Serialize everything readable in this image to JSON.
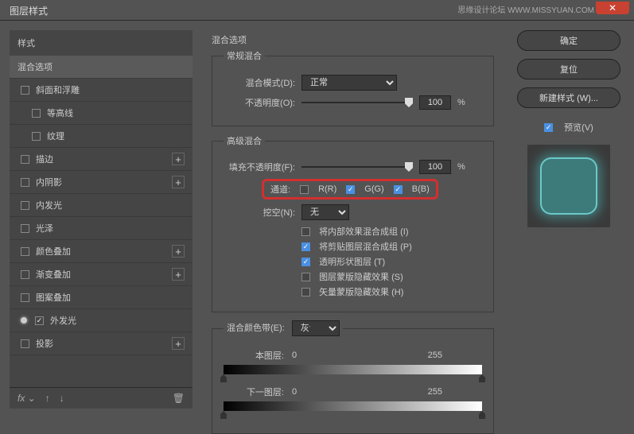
{
  "window": {
    "title": "图层样式",
    "watermark": "思缘设计论坛 WWW.MISSYUAN.COM"
  },
  "sidebar": {
    "header": "样式",
    "blending_options": "混合选项",
    "items": [
      {
        "label": "斜面和浮雕",
        "checked": false,
        "plus": false
      },
      {
        "label": "等高线",
        "checked": false,
        "plus": false,
        "indent": true
      },
      {
        "label": "纹理",
        "checked": false,
        "plus": false,
        "indent": true
      },
      {
        "label": "描边",
        "checked": false,
        "plus": true
      },
      {
        "label": "内阴影",
        "checked": false,
        "plus": true
      },
      {
        "label": "内发光",
        "checked": false,
        "plus": false
      },
      {
        "label": "光泽",
        "checked": false,
        "plus": false
      },
      {
        "label": "颜色叠加",
        "checked": false,
        "plus": true
      },
      {
        "label": "渐变叠加",
        "checked": false,
        "plus": true
      },
      {
        "label": "图案叠加",
        "checked": false,
        "plus": false
      },
      {
        "label": "外发光",
        "checked": true,
        "plus": false,
        "bullet": true
      },
      {
        "label": "投影",
        "checked": false,
        "plus": true
      }
    ],
    "footer": {
      "fx": "fx",
      "trash": "🗑"
    }
  },
  "content": {
    "section_title": "混合选项",
    "normal_blend": {
      "legend": "常规混合",
      "mode_label": "混合模式(D):",
      "mode_value": "正常",
      "opacity_label": "不透明度(O):",
      "opacity_value": "100",
      "percent": "%"
    },
    "advanced_blend": {
      "legend": "高级混合",
      "fill_label": "填充不透明度(F):",
      "fill_value": "100",
      "percent": "%",
      "channels_label": "通道:",
      "ch_r": "R(R)",
      "ch_g": "G(G)",
      "ch_b": "B(B)",
      "knockout_label": "挖空(N):",
      "knockout_value": "无",
      "cb1": "将内部效果混合成组 (I)",
      "cb2": "将剪贴图层混合成组 (P)",
      "cb3": "透明形状图层 (T)",
      "cb4": "图层蒙版隐藏效果 (S)",
      "cb5": "矢量蒙版隐藏效果 (H)"
    },
    "blend_if": {
      "legend": "混合颜色带(E):",
      "gray": "灰色",
      "this_layer": "本图层:",
      "underlying": "下一图层:",
      "v0": "0",
      "v255": "255"
    }
  },
  "right": {
    "ok": "确定",
    "cancel": "复位",
    "new_style": "新建样式 (W)...",
    "preview": "预览(V)"
  }
}
